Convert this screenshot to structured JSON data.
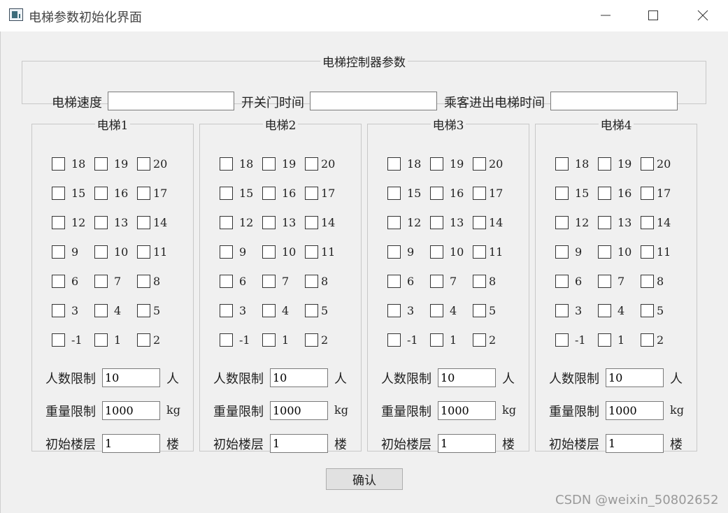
{
  "window": {
    "title": "电梯参数初始化界面",
    "icons": {
      "app": "app-window-icon",
      "minimize": "minimize-icon",
      "maximize": "maximize-icon",
      "close": "close-icon"
    }
  },
  "controller": {
    "legend": "电梯控制器参数",
    "speed_label": "电梯速度",
    "speed_value": "",
    "door_time_label": "开关门时间",
    "door_time_value": "",
    "passenger_time_label": "乘客进出电梯时间",
    "passenger_time_value": ""
  },
  "floor_rows": [
    [
      "18",
      "19",
      "20"
    ],
    [
      "15",
      "16",
      "17"
    ],
    [
      "12",
      "13",
      "14"
    ],
    [
      "9",
      "10",
      "11"
    ],
    [
      "6",
      "7",
      "8"
    ],
    [
      "3",
      "4",
      "5"
    ],
    [
      "-1",
      "1",
      "2"
    ]
  ],
  "elevators": [
    {
      "title": "电梯1",
      "capacity_label": "人数限制",
      "capacity_value": "10",
      "capacity_unit": "人",
      "weight_label": "重量限制",
      "weight_value": "1000",
      "weight_unit": "kg",
      "start_label": "初始楼层",
      "start_value": "1",
      "start_unit": "楼"
    },
    {
      "title": "电梯2",
      "capacity_label": "人数限制",
      "capacity_value": "10",
      "capacity_unit": "人",
      "weight_label": "重量限制",
      "weight_value": "1000",
      "weight_unit": "kg",
      "start_label": "初始楼层",
      "start_value": "1",
      "start_unit": "楼"
    },
    {
      "title": "电梯3",
      "capacity_label": "人数限制",
      "capacity_value": "10",
      "capacity_unit": "人",
      "weight_label": "重量限制",
      "weight_value": "1000",
      "weight_unit": "kg",
      "start_label": "初始楼层",
      "start_value": "1",
      "start_unit": "楼"
    },
    {
      "title": "电梯4",
      "capacity_label": "人数限制",
      "capacity_value": "10",
      "capacity_unit": "人",
      "weight_label": "重量限制",
      "weight_value": "1000",
      "weight_unit": "kg",
      "start_label": "初始楼层",
      "start_value": "1",
      "start_unit": "楼"
    }
  ],
  "confirm_label": "确认",
  "watermark": "CSDN @weixin_50802652"
}
